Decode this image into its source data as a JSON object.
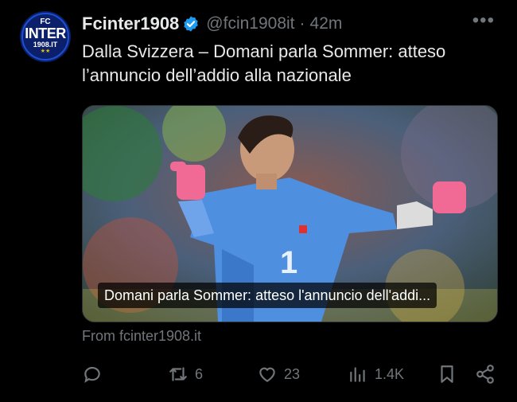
{
  "tweet": {
    "author_name": "Fcinter1908",
    "handle": "@fcin1908it",
    "separator": "·",
    "time": "42m",
    "more_label": "•••",
    "text": "Dalla Svizzera – Domani parla Sommer: atteso l’annuncio dell’addio alla nazionale",
    "avatar": {
      "top": "FC",
      "middle": "INTER",
      "bottom": "1908.IT",
      "stars": "★★"
    },
    "card": {
      "caption": "Domani parla Sommer: atteso l'annuncio dell'addi...",
      "jersey_number": "1"
    },
    "source": "From fcinter1908.it"
  },
  "actions": {
    "reply": {
      "icon": "reply-icon",
      "count": ""
    },
    "retweet": {
      "icon": "retweet-icon",
      "count": "6"
    },
    "like": {
      "icon": "heart-icon",
      "count": "23"
    },
    "views": {
      "icon": "views-icon",
      "count": "1.4K"
    },
    "bookmark": {
      "icon": "bookmark-icon"
    },
    "share": {
      "icon": "share-icon"
    }
  },
  "colors": {
    "background": "#000000",
    "text_primary": "#e7e9ea",
    "text_secondary": "#71767b",
    "verified_badge": "#1d9bf0"
  }
}
